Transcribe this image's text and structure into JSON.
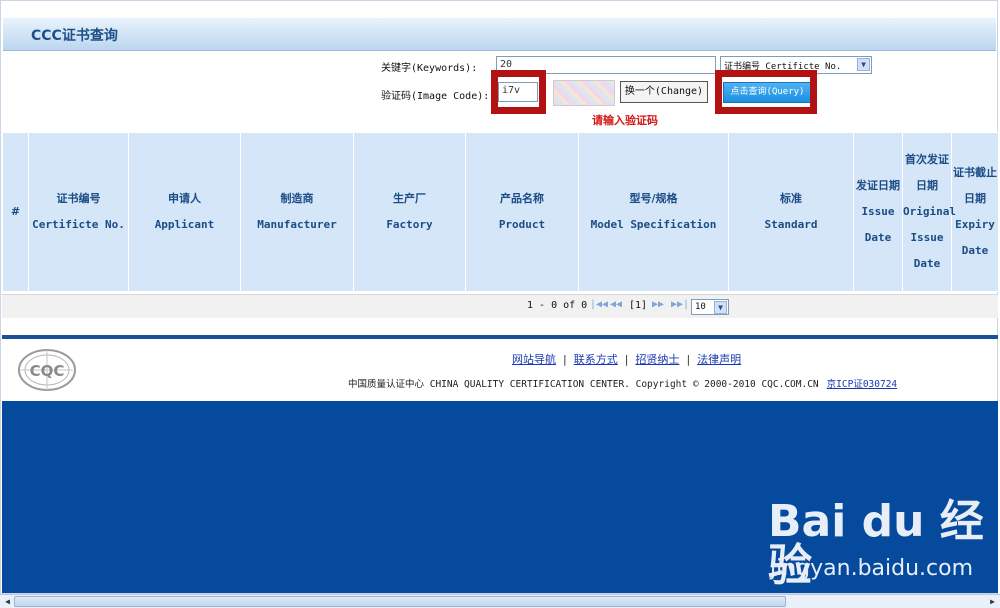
{
  "header": {
    "title": "CCC证书查询"
  },
  "search": {
    "keywords_label": "关键字(Keywords):",
    "keywords_value": "20",
    "type_select": "证书编号 Certificte No.",
    "captcha_label": "验证码(Image Code):",
    "captcha_value": "i7v",
    "change_button": "换一个(Change)",
    "query_button": "点击查询(Query)",
    "prompt": "请输入验证码"
  },
  "table": {
    "columns": [
      {
        "cn": "#",
        "en": ""
      },
      {
        "cn": "证书编号",
        "en": "Certificte No."
      },
      {
        "cn": "申请人",
        "en": "Applicant"
      },
      {
        "cn": "制造商",
        "en": "Manufacturer"
      },
      {
        "cn": "生产厂",
        "en": "Factory"
      },
      {
        "cn": "产品名称",
        "en": "Product"
      },
      {
        "cn": "型号/规格",
        "en": "Model Specification"
      },
      {
        "cn": "标准",
        "en": "Standard"
      },
      {
        "cn": "发证日期",
        "en": "Issue Date"
      },
      {
        "cn": "首次发证日期",
        "en": "Original Issue Date"
      },
      {
        "cn": "证书截止日期",
        "en": "Expiry Date"
      }
    ]
  },
  "pager": {
    "summary": "1 - 0 of 0",
    "current": "[1]",
    "page_size": "10"
  },
  "footer": {
    "links": [
      "网站导航",
      "联系方式",
      "招贤纳士",
      "法律声明"
    ],
    "copyright": "中国质量认证中心 CHINA QUALITY CERTIFICATION CENTER. Copyright © 2000-2010 CQC.COM.CN",
    "icp": "京ICP证030724",
    "logo_text": "CQC"
  },
  "watermark": {
    "brand": "Bai du 经验",
    "url": "jingyan.baidu.com"
  },
  "colors": {
    "accent": "#1e4f9a",
    "highlight": "#b31212",
    "prompt": "#d21a1a",
    "header_text": "#1c4c86"
  }
}
